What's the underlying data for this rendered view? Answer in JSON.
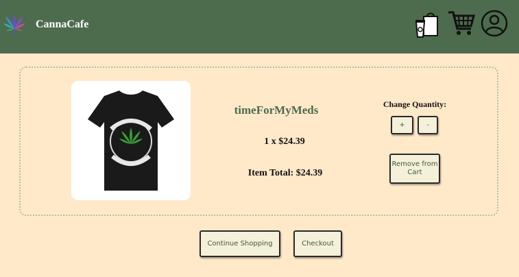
{
  "header": {
    "brand": "CannaCafe",
    "icons": [
      "cannabis-logo-icon",
      "order-bag-icon",
      "shopping-cart-icon",
      "account-icon"
    ]
  },
  "cart_item": {
    "image_alt": "IT'S TIME FOR MY MEDICINE t-shirt",
    "name": "timeForMyMeds",
    "quantity_line": "1 x $24.39",
    "item_total": "Item Total: $24.39",
    "change_quantity_label": "Change Quantity:",
    "increase_label": "+",
    "decrease_label": "-",
    "remove_label": "Remove from Cart"
  },
  "actions": {
    "continue_label": "Continue Shopping",
    "checkout_label": "Checkout"
  },
  "colors": {
    "header": "#4d6b4d",
    "background": "#ffe9c9",
    "button": "#f5f0d9",
    "accent_text": "#4d6b4d"
  }
}
